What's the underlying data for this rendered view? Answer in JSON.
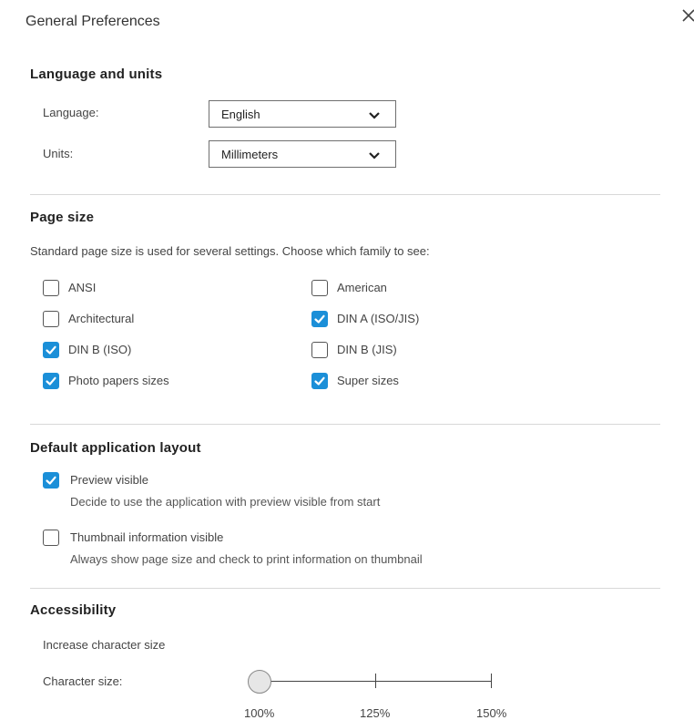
{
  "dialog": {
    "title": "General Preferences",
    "close_icon": "close-icon"
  },
  "language_units": {
    "heading": "Language and units",
    "language_label": "Language:",
    "language_value": "English",
    "units_label": "Units:",
    "units_value": "Millimeters"
  },
  "page_size": {
    "heading": "Page size",
    "description": "Standard page size is used for several settings. Choose which family to see:",
    "options": [
      {
        "label": "ANSI",
        "checked": false
      },
      {
        "label": "American",
        "checked": false
      },
      {
        "label": "Architectural",
        "checked": false
      },
      {
        "label": "DIN A (ISO/JIS)",
        "checked": true
      },
      {
        "label": "DIN B (ISO)",
        "checked": true
      },
      {
        "label": "DIN B (JIS)",
        "checked": false
      },
      {
        "label": "Photo papers sizes",
        "checked": true
      },
      {
        "label": "Super sizes",
        "checked": true
      }
    ]
  },
  "layout": {
    "heading": "Default application layout",
    "preview_label": "Preview visible",
    "preview_checked": true,
    "preview_desc": "Decide to use the application with preview visible from start",
    "thumbnail_label": "Thumbnail information visible",
    "thumbnail_checked": false,
    "thumbnail_desc": "Always show page size and check to print information on thumbnail"
  },
  "accessibility": {
    "heading": "Accessibility",
    "subheading": "Increase character size",
    "slider_label": "Character size:",
    "ticks": [
      "100%",
      "125%",
      "150%"
    ],
    "selected": "100%"
  },
  "colors": {
    "accent": "#1b8fd8",
    "divider": "#d8d8d8",
    "text": "#333333"
  }
}
